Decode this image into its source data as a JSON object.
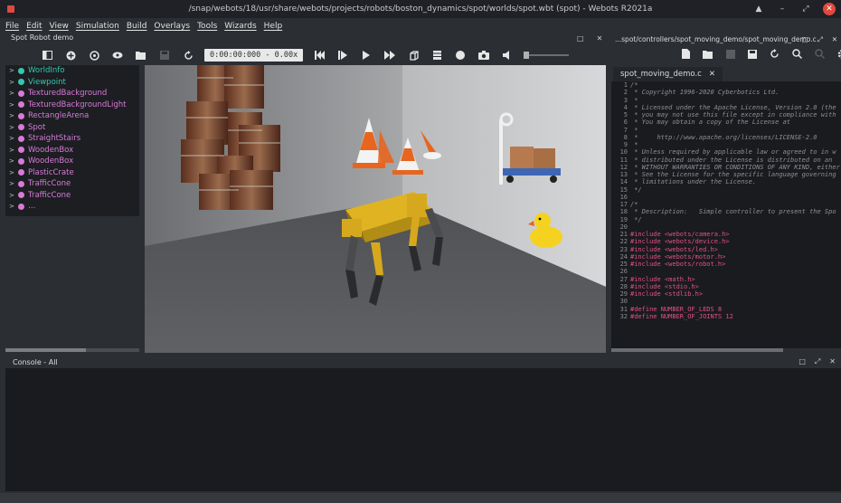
{
  "window": {
    "title": "/snap/webots/18/usr/share/webots/projects/robots/boston_dynamics/spot/worlds/spot.wbt (spot) - Webots R2021a",
    "buttons": [
      "▲",
      "–",
      "⤢",
      "✕"
    ]
  },
  "menu": [
    "File",
    "Edit",
    "View",
    "Simulation",
    "Build",
    "Overlays",
    "Tools",
    "Wizards",
    "Help"
  ],
  "scene_panel": {
    "title": "Spot Robot demo",
    "items": [
      {
        "label": "WorldInfo",
        "color": "teal"
      },
      {
        "label": "Viewpoint",
        "color": "teal"
      },
      {
        "label": "TexturedBackground",
        "color": "pink"
      },
      {
        "label": "TexturedBackgroundLight",
        "color": "pink"
      },
      {
        "label": "RectangleArena",
        "color": "pink"
      },
      {
        "label": "Spot",
        "color": "pink"
      },
      {
        "label": "StraightStairs",
        "color": "pink"
      },
      {
        "label": "WoodenBox",
        "color": "pink"
      },
      {
        "label": "WoodenBox",
        "color": "pink"
      },
      {
        "label": "PlasticCrate",
        "color": "pink"
      },
      {
        "label": "TrafficCone",
        "color": "pink"
      },
      {
        "label": "TrafficCone",
        "color": "pink"
      },
      {
        "label": "…",
        "color": "pink"
      }
    ]
  },
  "toolbar": {
    "time": "0:00:00:000",
    "speed": "- 0.00x"
  },
  "center_panel": {
    "buttons": [
      "□",
      "✕"
    ]
  },
  "editor": {
    "path": "...spot/controllers/spot_moving_demo/spot_moving_demo.c",
    "tab_label": "spot_moving_demo.c",
    "tab_close": "✕",
    "header_buttons": [
      "□",
      "⤢",
      "✕"
    ],
    "lines": [
      {
        "n": "1",
        "t": "/*",
        "k": "comment"
      },
      {
        "n": "2",
        "t": " * Copyright 1996-2020 Cyberbotics Ltd.",
        "k": "comment"
      },
      {
        "n": "3",
        "t": " *",
        "k": "comment"
      },
      {
        "n": "4",
        "t": " * Licensed under the Apache License, Version 2.0 (the",
        "k": "comment"
      },
      {
        "n": "5",
        "t": " * you may not use this file except in compliance with",
        "k": "comment"
      },
      {
        "n": "6",
        "t": " * You may obtain a copy of the License at",
        "k": "comment"
      },
      {
        "n": "7",
        "t": " *",
        "k": "comment"
      },
      {
        "n": "8",
        "t": " *     http://www.apache.org/licenses/LICENSE-2.0",
        "k": "comment"
      },
      {
        "n": "9",
        "t": " *",
        "k": "comment"
      },
      {
        "n": "10",
        "t": " * Unless required by applicable law or agreed to in w",
        "k": "comment"
      },
      {
        "n": "11",
        "t": " * distributed under the License is distributed on an",
        "k": "comment"
      },
      {
        "n": "12",
        "t": " * WITHOUT WARRANTIES OR CONDITIONS OF ANY KIND, either",
        "k": "comment"
      },
      {
        "n": "13",
        "t": " * See the License for the specific language governing",
        "k": "comment"
      },
      {
        "n": "14",
        "t": " * limitations under the License.",
        "k": "comment"
      },
      {
        "n": "15",
        "t": " */",
        "k": "comment"
      },
      {
        "n": "16",
        "t": "",
        "k": "plain"
      },
      {
        "n": "17",
        "t": "/*",
        "k": "comment"
      },
      {
        "n": "18",
        "t": " * Description:   Simple controller to present the Spo",
        "k": "comment"
      },
      {
        "n": "19",
        "t": " */",
        "k": "comment"
      },
      {
        "n": "20",
        "t": "",
        "k": "plain"
      },
      {
        "n": "21",
        "t": "#include <webots/camera.h>",
        "k": "pre"
      },
      {
        "n": "22",
        "t": "#include <webots/device.h>",
        "k": "pre"
      },
      {
        "n": "23",
        "t": "#include <webots/led.h>",
        "k": "pre"
      },
      {
        "n": "24",
        "t": "#include <webots/motor.h>",
        "k": "pre"
      },
      {
        "n": "25",
        "t": "#include <webots/robot.h>",
        "k": "pre"
      },
      {
        "n": "26",
        "t": "",
        "k": "plain"
      },
      {
        "n": "27",
        "t": "#include <math.h>",
        "k": "pre"
      },
      {
        "n": "28",
        "t": "#include <stdio.h>",
        "k": "pre"
      },
      {
        "n": "29",
        "t": "#include <stdlib.h>",
        "k": "pre"
      },
      {
        "n": "30",
        "t": "",
        "k": "plain"
      },
      {
        "n": "31",
        "t": "#define NUMBER_OF_LEDS 8",
        "k": "pre"
      },
      {
        "n": "32",
        "t": "#define NUMBER_OF_JOINTS 12",
        "k": "pre"
      }
    ]
  },
  "console": {
    "title": "Console - All",
    "buttons": [
      "□",
      "⤢",
      "✕"
    ]
  }
}
